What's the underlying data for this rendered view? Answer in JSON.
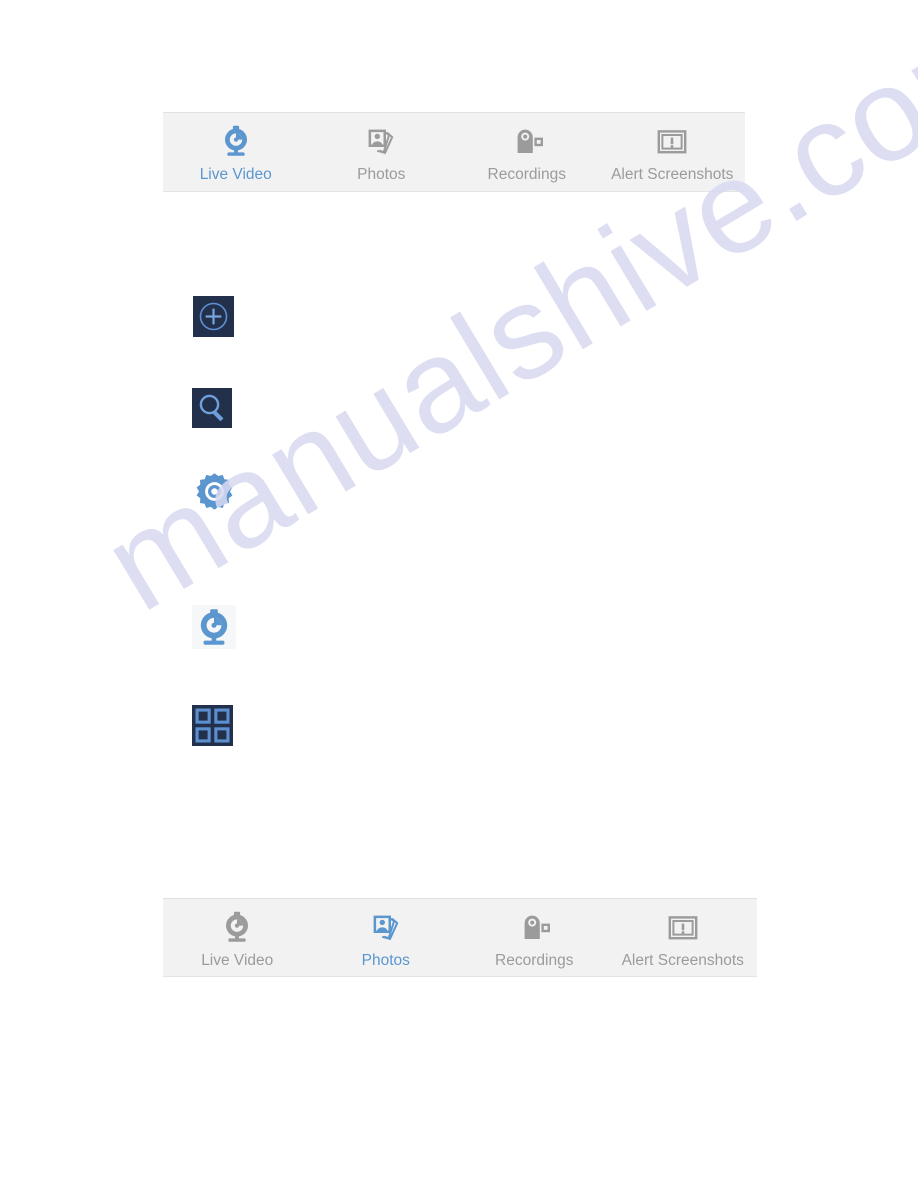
{
  "app": {
    "accent_color": "#5b96cf",
    "inactive_color": "#9b9b9b",
    "bar_background": "#f2f2f2",
    "page_background": "#ffffff"
  },
  "watermark": {
    "text": "manualshive.com",
    "color": "#d9d9f2"
  },
  "top_tabbar": {
    "active_tab": "Live Video",
    "tabs": [
      {
        "label": "Live Video",
        "icon": "webcam-icon",
        "active": true
      },
      {
        "label": "Photos",
        "icon": "photo-stack-icon",
        "active": false
      },
      {
        "label": "Recordings",
        "icon": "camcorder-icon",
        "active": false
      },
      {
        "label": "Alert Screenshots",
        "icon": "alert-screenshot-icon",
        "active": false
      }
    ]
  },
  "bottom_tabbar": {
    "active_tab": "Photos",
    "tabs": [
      {
        "label": "Live Video",
        "icon": "webcam-icon",
        "active": false
      },
      {
        "label": "Photos",
        "icon": "photo-stack-icon",
        "active": true
      },
      {
        "label": "Recordings",
        "icon": "camcorder-icon",
        "active": false
      },
      {
        "label": "Alert Screenshots",
        "icon": "alert-screenshot-icon",
        "active": false
      }
    ]
  },
  "icon_column": {
    "items": [
      {
        "icon": "add-plus-circle-icon",
        "background": "dark",
        "color": "#5b8fd0"
      },
      {
        "icon": "search-magnifier-icon",
        "background": "dark",
        "color": "#5b8fd0"
      },
      {
        "icon": "settings-gear-icon",
        "background": "none",
        "color": "#5b96cf"
      },
      {
        "icon": "webcam-icon",
        "background": "light",
        "color": "#5b96cf"
      },
      {
        "icon": "grid-view-icon",
        "background": "dark",
        "color": "#5b8fd0"
      }
    ]
  }
}
